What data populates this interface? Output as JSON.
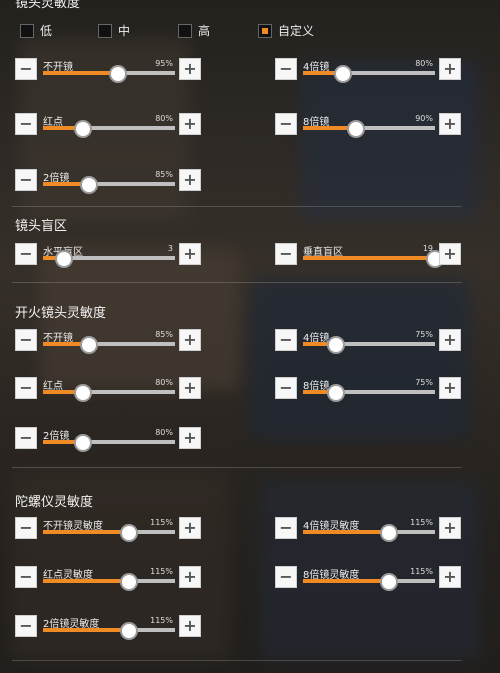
{
  "header": {
    "title_partial": "镜头灵敏度"
  },
  "presets": [
    {
      "label": "低",
      "checked": false
    },
    {
      "label": "中",
      "checked": false
    },
    {
      "label": "高",
      "checked": false
    },
    {
      "label": "自定义",
      "checked": true
    }
  ],
  "sections": {
    "camera_sensitivity": {
      "sliders": {
        "no_scope": {
          "label": "不开镜",
          "value_text": "95%",
          "value": 0.57
        },
        "scope4x": {
          "label": "4倍镜",
          "value_text": "80%",
          "value": 0.3
        },
        "red_dot": {
          "label": "红点",
          "value_text": "80%",
          "value": 0.3
        },
        "scope8x": {
          "label": "8倍镜",
          "value_text": "90%",
          "value": 0.4
        },
        "scope2x": {
          "label": "2倍镜",
          "value_text": "85%",
          "value": 0.35
        }
      }
    },
    "camera_deadzone": {
      "title": "镜头盲区",
      "sliders": {
        "horizontal": {
          "label": "水平盲区",
          "value_text": "3",
          "value": 0.16
        },
        "vertical": {
          "label": "垂直盲区",
          "value_text": "19",
          "value": 1.0
        }
      }
    },
    "fire_sensitivity": {
      "title": "开火镜头灵敏度",
      "sliders": {
        "no_scope": {
          "label": "不开镜",
          "value_text": "85%",
          "value": 0.35
        },
        "scope4x": {
          "label": "4倍镜",
          "value_text": "75%",
          "value": 0.25
        },
        "red_dot": {
          "label": "红点",
          "value_text": "80%",
          "value": 0.3
        },
        "scope8x": {
          "label": "8倍镜",
          "value_text": "75%",
          "value": 0.25
        },
        "scope2x": {
          "label": "2倍镜",
          "value_text": "80%",
          "value": 0.3
        }
      }
    },
    "gyro_sensitivity": {
      "title": "陀螺仪灵敏度",
      "sliders": {
        "no_scope": {
          "label": "不开镜灵敏度",
          "value_text": "115%",
          "value": 0.65
        },
        "scope4x": {
          "label": "4倍镜灵敏度",
          "value_text": "115%",
          "value": 0.65
        },
        "red_dot": {
          "label": "红点灵敏度",
          "value_text": "115%",
          "value": 0.65
        },
        "scope8x": {
          "label": "8倍镜灵敏度",
          "value_text": "115%",
          "value": 0.65
        },
        "scope2x": {
          "label": "2倍镜灵敏度",
          "value_text": "115%",
          "value": 0.65
        }
      }
    }
  },
  "controls": {
    "minus": "−",
    "plus": "+"
  },
  "colors": {
    "accent": "#f08a24",
    "track": "#bfbfbf",
    "button_bg": "#f7f7f7"
  }
}
